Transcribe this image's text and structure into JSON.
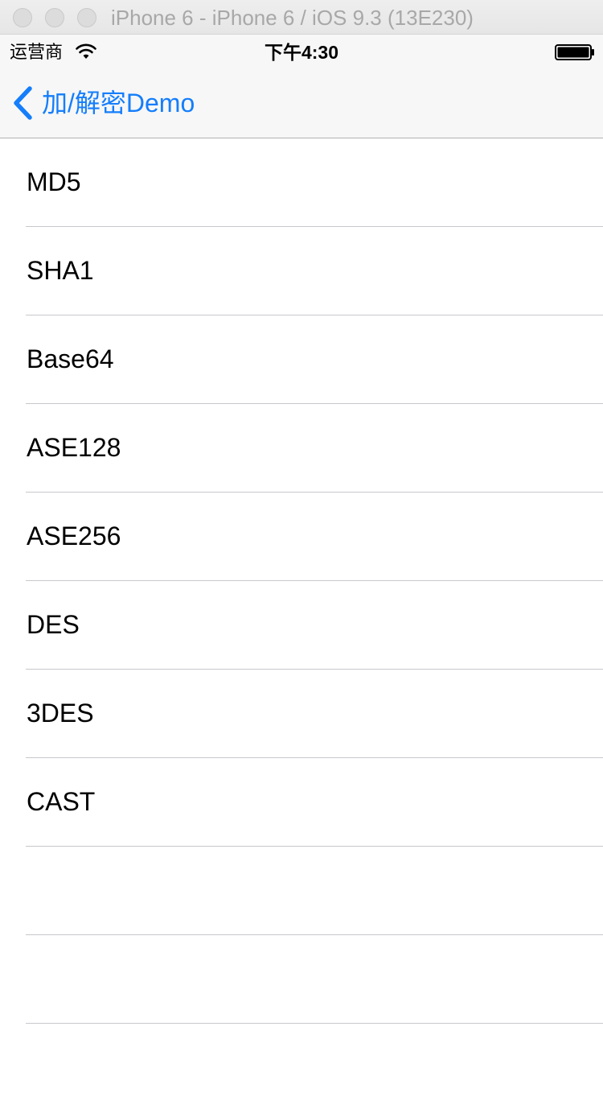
{
  "window": {
    "title": "iPhone 6 - iPhone 6 / iOS 9.3 (13E230)"
  },
  "status_bar": {
    "carrier": "运营商",
    "time": "下午4:30",
    "icons": [
      "wifi-icon",
      "battery-icon"
    ]
  },
  "nav_bar": {
    "back_label": "加/解密Demo",
    "back_icon": "chevron-left-icon",
    "tint_color": "#157efb"
  },
  "table": {
    "rows": [
      {
        "label": "MD5"
      },
      {
        "label": "SHA1"
      },
      {
        "label": "Base64"
      },
      {
        "label": "ASE128"
      },
      {
        "label": "ASE256"
      },
      {
        "label": "DES"
      },
      {
        "label": "3DES"
      },
      {
        "label": "CAST"
      },
      {
        "label": ""
      },
      {
        "label": ""
      },
      {
        "label": ""
      }
    ]
  }
}
